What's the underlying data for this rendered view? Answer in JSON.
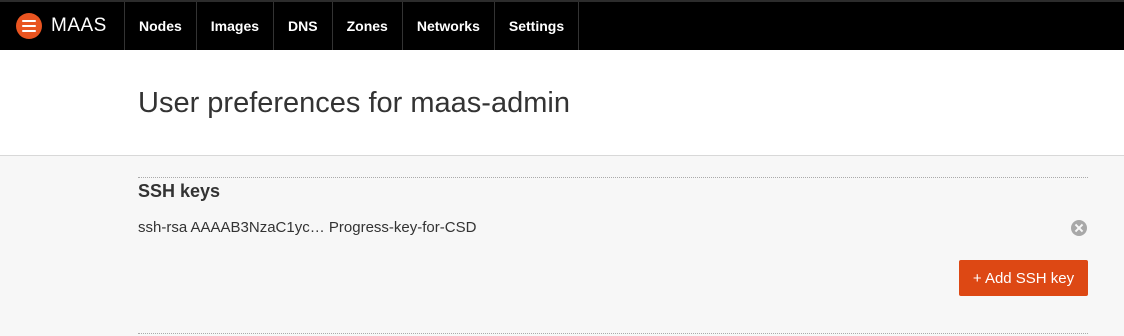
{
  "brand": {
    "name": "MAAS",
    "logo_icon": "maas-logo-icon",
    "accent": "#e95420"
  },
  "nav": {
    "items": [
      "Nodes",
      "Images",
      "DNS",
      "Zones",
      "Networks",
      "Settings"
    ]
  },
  "page": {
    "title": "User preferences for maas-admin"
  },
  "ssh_keys": {
    "title": "SSH keys",
    "keys": [
      {
        "text": "ssh-rsa AAAAB3NzaC1yc… Progress-key-for-CSD"
      }
    ],
    "add_button_label": "+ Add SSH key",
    "button_color": "#dd4814"
  }
}
